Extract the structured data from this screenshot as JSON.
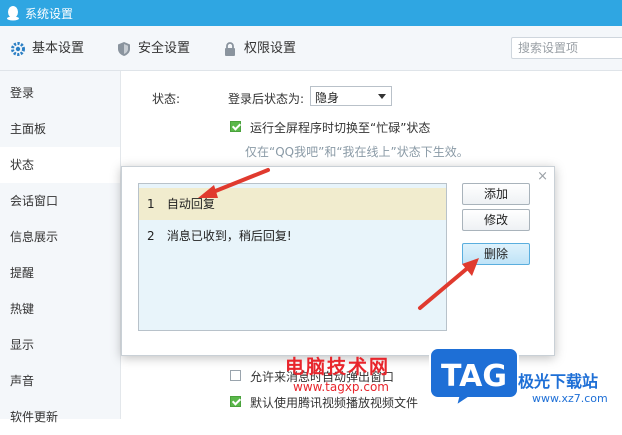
{
  "window": {
    "title": "系统设置"
  },
  "topnav": {
    "tabs": [
      {
        "label": "基本设置",
        "icon": "gear-icon"
      },
      {
        "label": "安全设置",
        "icon": "shield-icon"
      },
      {
        "label": "权限设置",
        "icon": "lock-icon"
      }
    ],
    "search_placeholder": "搜索设置项"
  },
  "sidebar": {
    "items": [
      {
        "label": "登录"
      },
      {
        "label": "主面板"
      },
      {
        "label": "状态",
        "active": true
      },
      {
        "label": "会话窗口"
      },
      {
        "label": "信息展示"
      },
      {
        "label": "提醒"
      },
      {
        "label": "热键"
      },
      {
        "label": "显示"
      },
      {
        "label": "声音"
      },
      {
        "label": "软件更新"
      }
    ]
  },
  "status_section": {
    "section_label": "状态:",
    "login_status_label": "登录后状态为:",
    "login_status_value": "隐身",
    "fullscreen_busy": {
      "label": "运行全屏程序时切换至“忙碌”状态",
      "checked": true
    },
    "hint": "仅在“QQ我吧”和“我在线上”状态下生效。",
    "allow_label": "允许来消息时自动弹出窗口",
    "default_label": "默认使用腾讯视频播放视频文件"
  },
  "dialog": {
    "close": "×",
    "replies": [
      {
        "num": "1",
        "text": "自动回复",
        "selected": true
      },
      {
        "num": "2",
        "text": "消息已收到，稍后回复!",
        "selected": false
      }
    ],
    "buttons": {
      "add": "添加",
      "edit": "修改",
      "delete": "删除"
    }
  },
  "watermark": {
    "site_name": "电脑技术网",
    "site_url": "www.tagxp.com",
    "badge": "TAG",
    "right_text": "极光下载站",
    "right_url": "www.xz7.com"
  },
  "colors": {
    "titlebar": "#2fa6e2",
    "selected_row": "#f1ecce",
    "listbox_bg": "#e8f4fa",
    "arrow_red": "#e03a2e",
    "watermark_red": "#e8252c",
    "badge_blue": "#1e6fd6"
  }
}
